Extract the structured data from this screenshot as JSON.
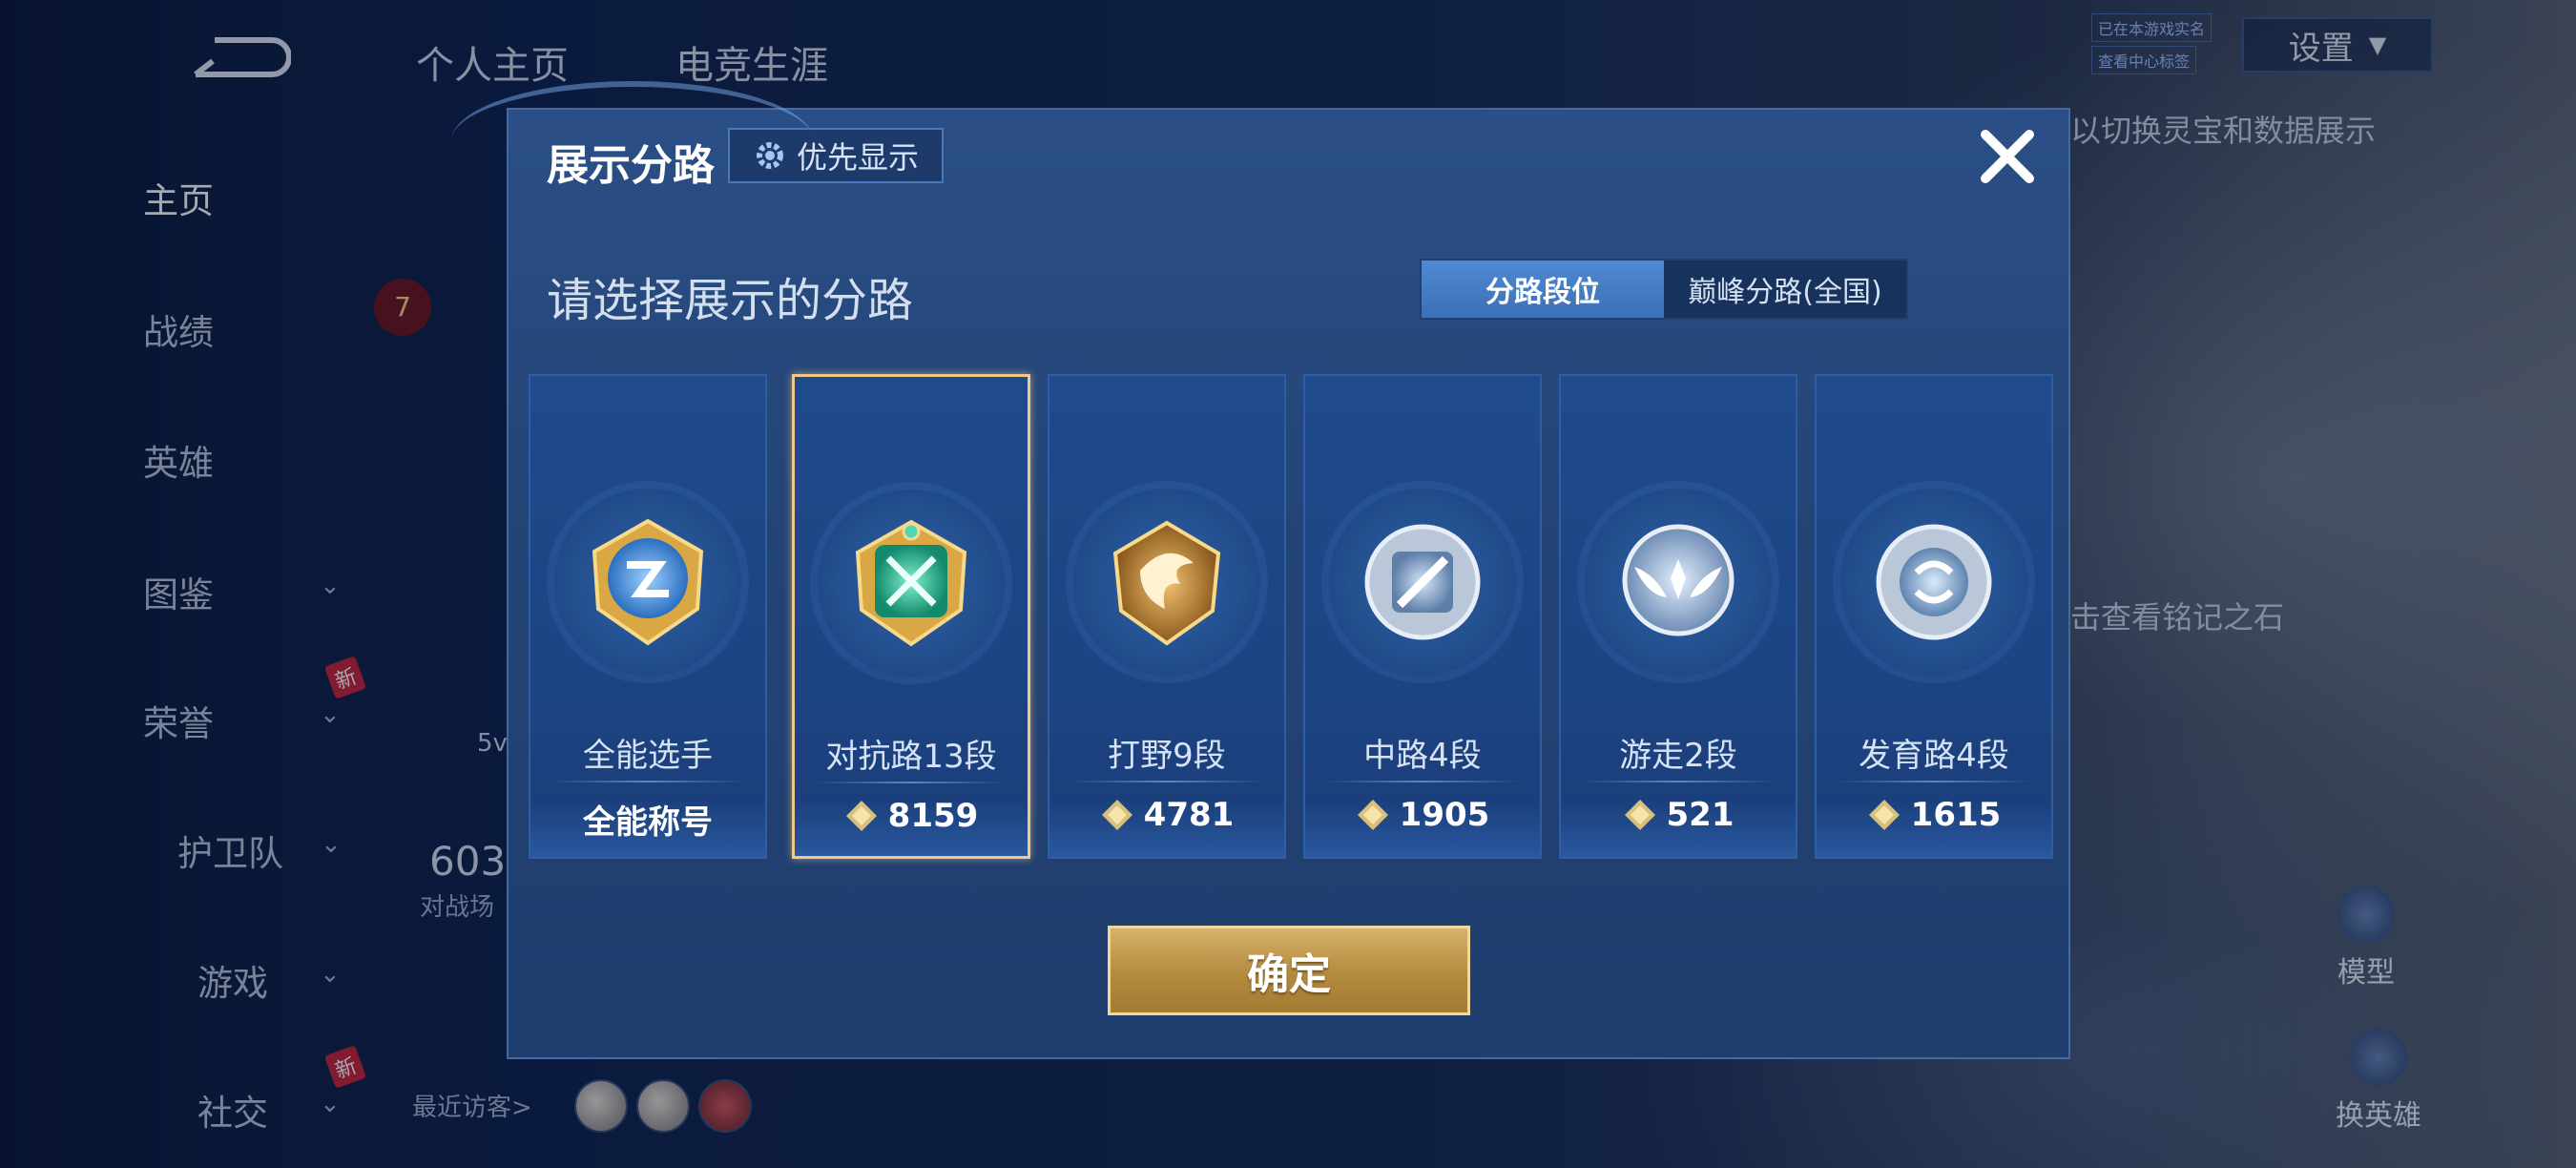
{
  "nav": {
    "items": [
      {
        "label": "主页",
        "active": true
      },
      {
        "label": "战绩"
      },
      {
        "label": "英雄"
      },
      {
        "label": "图鉴",
        "chevron": true
      },
      {
        "label": "荣誉",
        "chevron": true,
        "badge": "新"
      },
      {
        "label": "护卫队",
        "chevron": true
      },
      {
        "label": "游戏",
        "chevron": true
      },
      {
        "label": "社交",
        "chevron": true,
        "badge": "新"
      }
    ]
  },
  "top": {
    "tabs": [
      "个人主页",
      "电竞生涯"
    ],
    "settings_label": "设置",
    "mini_tag_1": "已在本游戏实名",
    "mini_tag_2": "查看中心标签"
  },
  "background": {
    "hint_text": "以切换灵宝和数据展示",
    "inscription_text": "击查看铭记之石",
    "level": "7",
    "stat_partial": "5v",
    "matches_num": "603",
    "matches_label": "对战场",
    "recent_visitors": "最近访客>",
    "model_label": "模型",
    "switch_hero_label": "换英雄"
  },
  "dialog": {
    "title": "展示分路",
    "priority_label": "优先显示",
    "subtitle": "请选择展示的分路",
    "segment": {
      "option_1": "分路段位",
      "option_2": "巅峰分路(全国)",
      "selected": "分路段位"
    },
    "cards": [
      {
        "role": "全能选手",
        "value": "全能称号",
        "selected": false,
        "medal": "all-round-medal"
      },
      {
        "role": "对抗路13段",
        "value": "8159",
        "selected": true,
        "medal": "clash-lane-medal"
      },
      {
        "role": "打野9段",
        "value": "4781",
        "selected": false,
        "medal": "jungle-medal"
      },
      {
        "role": "中路4段",
        "value": "1905",
        "selected": false,
        "medal": "mid-lane-medal"
      },
      {
        "role": "游走2段",
        "value": "521",
        "selected": false,
        "medal": "roam-medal"
      },
      {
        "role": "发育路4段",
        "value": "1615",
        "selected": false,
        "medal": "farm-lane-medal"
      }
    ],
    "confirm_label": "确定"
  },
  "colors": {
    "accent_gold": "#d6b26a",
    "selected_border": "#f0c98a",
    "dialog_bg": "#244577"
  }
}
